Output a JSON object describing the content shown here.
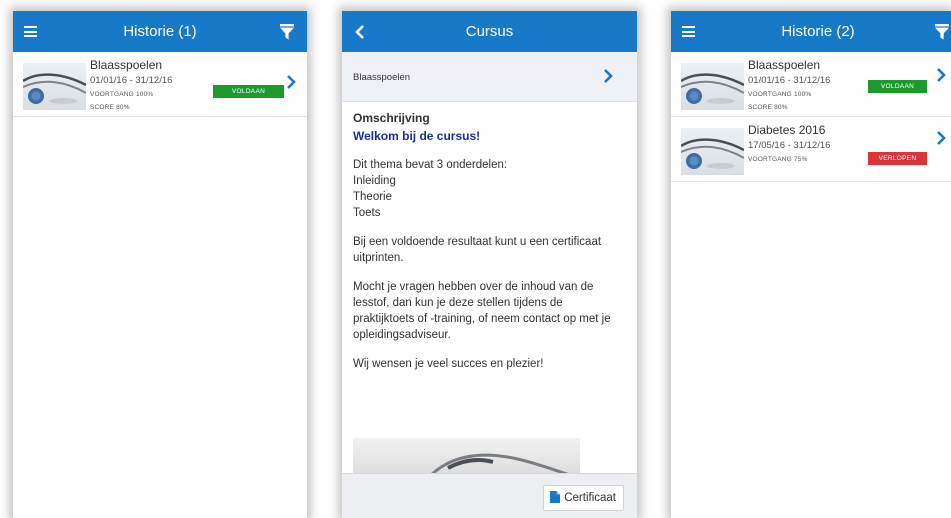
{
  "screen1": {
    "header_title": "Historie (1)",
    "items": [
      {
        "title": "Blaasspoelen",
        "dates": "01/01/16 - 31/12/16",
        "progress": "VOORTGANG 100%",
        "score": "SCORE 80%",
        "badge": "VOLDAAN",
        "badge_color": "#1c9a2b"
      }
    ]
  },
  "screen2": {
    "header_title": "Cursus",
    "course_name": "Blaasspoelen",
    "heading": "Omschrijving",
    "welcome": "Welkom bij de cursus!",
    "intro": "Dit thema bevat 3 onderdelen:",
    "parts": [
      "Inleiding",
      "Theorie",
      "Toets"
    ],
    "paragraph1": "Bij een voldoende resultaat kunt u een certificaat uitprinten.",
    "paragraph2": "Mocht je vragen hebben over de inhoud van de lesstof, dan kun je deze stellen tijdens de praktijktoets of -training, of neem contact op met je opleidingsadviseur.",
    "paragraph3": "Wij wensen je veel succes en plezier!",
    "certificate_label": "Certificaat"
  },
  "screen3": {
    "header_title": "Historie (2)",
    "items": [
      {
        "title": "Blaasspoelen",
        "dates": "01/01/16 - 31/12/16",
        "progress": "VOORTGANG 100%",
        "score": "SCORE 80%",
        "badge": "VOLDAAN",
        "badge_color": "#1c9a2b"
      },
      {
        "title": "Diabetes 2016",
        "dates": "17/05/16 - 31/12/16",
        "progress": "VOORTGANG 75%",
        "badge": "VERLOPEN",
        "badge_color": "#d9353a"
      }
    ]
  },
  "colors": {
    "header": "#1879c8",
    "welcome_text": "#17309c",
    "chevron": "#1879c8"
  },
  "icons": [
    "menu-icon",
    "filter-icon",
    "back-icon",
    "chevron-right-icon",
    "document-icon",
    "stethoscope-image"
  ]
}
